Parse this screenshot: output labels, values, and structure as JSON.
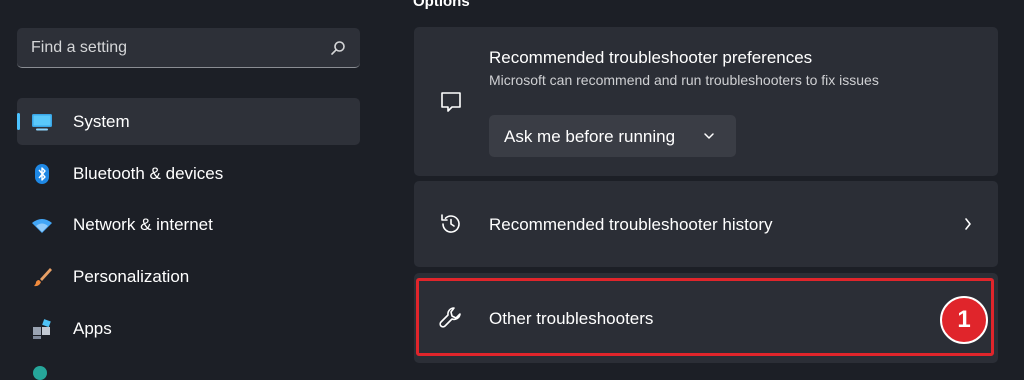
{
  "search": {
    "placeholder": "Find a setting",
    "icon": "search-icon"
  },
  "sidebar": {
    "items": [
      {
        "label": "System",
        "icon": "monitor-icon",
        "active": true
      },
      {
        "label": "Bluetooth & devices",
        "icon": "bluetooth-icon"
      },
      {
        "label": "Network & internet",
        "icon": "wifi-icon"
      },
      {
        "label": "Personalization",
        "icon": "brush-icon"
      },
      {
        "label": "Apps",
        "icon": "apps-icon"
      }
    ]
  },
  "main": {
    "section_title": "Options",
    "cards": [
      {
        "title": "Recommended troubleshooter preferences",
        "subtitle": "Microsoft can recommend and run troubleshooters to fix issues",
        "icon": "chat-bubble-icon",
        "dropdown_value": "Ask me before running"
      },
      {
        "title": "Recommended troubleshooter history",
        "icon": "history-icon"
      },
      {
        "title": "Other troubleshooters",
        "icon": "wrench-icon"
      }
    ],
    "callout_number": "1"
  },
  "colors": {
    "accent": "#4cc2ff",
    "highlight": "#e0252b",
    "background": "#1c1f26",
    "card": "#2b2e36"
  }
}
